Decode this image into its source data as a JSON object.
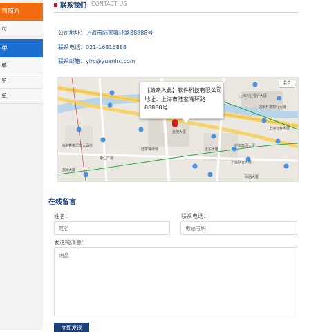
{
  "sidebar": {
    "orange_item": "司简介",
    "items_top": [
      "司"
    ],
    "blue_item": "单",
    "items_bottom": [
      "单",
      "单",
      "单"
    ]
  },
  "header": {
    "title": "联系我们",
    "subtitle": "CONTACT US"
  },
  "contact": {
    "address": "公司地址：上海市陆家嘴环路88888号",
    "phone": "联系电话：021-16816888",
    "email": "联系邮箱：ylrc@yuanlrc.com"
  },
  "map": {
    "popup_company": "【猿来入此】软件科技有限公司",
    "popup_address_1": "地址：上海市陆家嘴环路",
    "popup_address_2": "88888号",
    "close_symbol": "×",
    "map_type_button": "混合",
    "labels": [
      "中国大厦",
      "上海兴业银行大厦",
      "国家开发银行大厦",
      "上海证券大厦",
      "花旗集团大厦",
      "华能联合大厦",
      "浦东香格里拉大酒店",
      "国际大厦",
      "陆家嘴绿地",
      "金茂大厦",
      "远东大厦",
      "港汇广场",
      "凤凰大厦"
    ]
  },
  "form": {
    "title": "在线留言",
    "name_label": "姓名：",
    "name_placeholder": "姓名",
    "phone_label": "联系电话：",
    "phone_placeholder": "电话号码",
    "message_label": "发送的消息：",
    "message_placeholder": "消息",
    "submit_label": "立即发送"
  },
  "colors": {
    "accent_blue": "#1d3f7a",
    "sidebar_orange": "#f06a0e",
    "sidebar_blue": "#1a6fd1",
    "marker_red": "#d61b1b"
  }
}
